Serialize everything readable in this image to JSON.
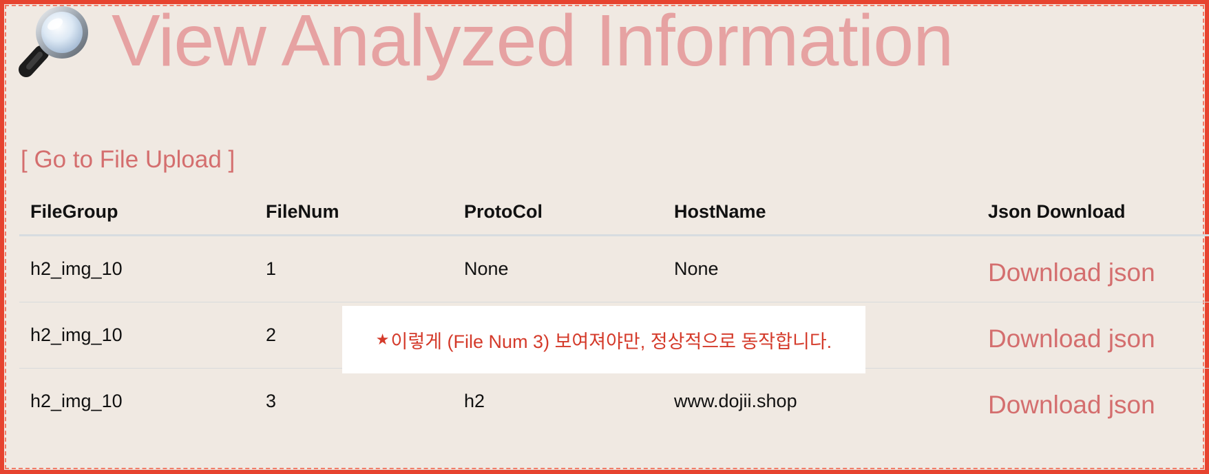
{
  "header": {
    "title": "View Analyzed Information",
    "icon": "magnifying-glass-icon"
  },
  "nav": {
    "upload_link": "[ Go to File Upload ]"
  },
  "table": {
    "columns": [
      "FileGroup",
      "FileNum",
      "ProtoCol",
      "HostName",
      "Json Download"
    ],
    "rows": [
      {
        "file_group": "h2_img_10",
        "file_num": "1",
        "protocol": "None",
        "hostname": "None",
        "download": "Download json"
      },
      {
        "file_group": "h2_img_10",
        "file_num": "2",
        "protocol": "",
        "hostname": "",
        "download": "Download json"
      },
      {
        "file_group": "h2_img_10",
        "file_num": "3",
        "protocol": "h2",
        "hostname": "www.dojii.shop",
        "download": "Download json"
      }
    ]
  },
  "annotation": {
    "star": "★",
    "text": "이렇게 (File Num 3) 보여져야만, 정상적으로 동작합니다."
  },
  "colors": {
    "background": "#f0e9e2",
    "title": "#e6a2a2",
    "link": "#d46e6e",
    "border": "#e6432f",
    "note_text": "#d43a2a"
  }
}
